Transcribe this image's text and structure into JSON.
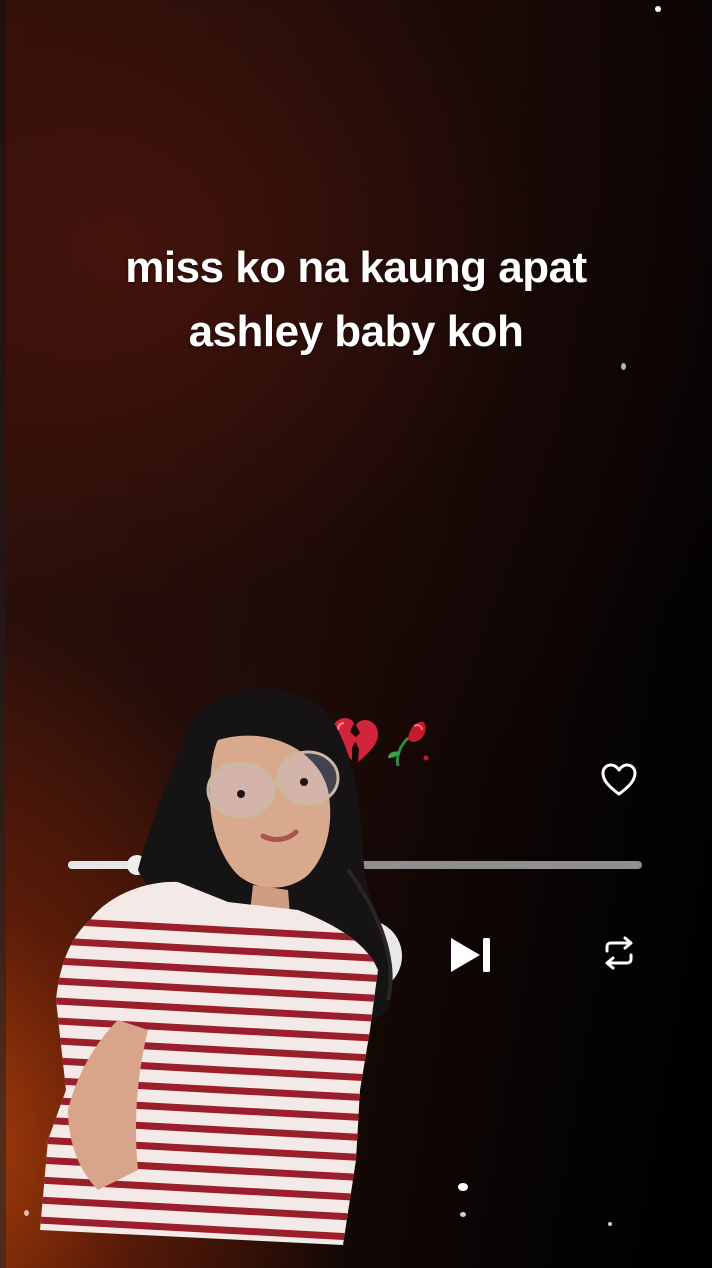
{
  "caption": {
    "line1": "miss ko na kaung apat",
    "line2": "ashley baby koh"
  },
  "player": {
    "progress": 0.12,
    "icons": {
      "like": "heart-outline-icon",
      "play": "play-pause-icon",
      "next": "skip-next-icon",
      "repeat": "repeat-icon"
    }
  },
  "decorations": {
    "emojis": [
      "broken-heart-emoji",
      "wilted-rose-emoji"
    ]
  },
  "colors": {
    "text": "#ffffff",
    "track": "#8f8f8f",
    "track_fill": "#e6e6e6",
    "glow": "#b8460a",
    "shirt_stripe": "#9a1f2a"
  }
}
